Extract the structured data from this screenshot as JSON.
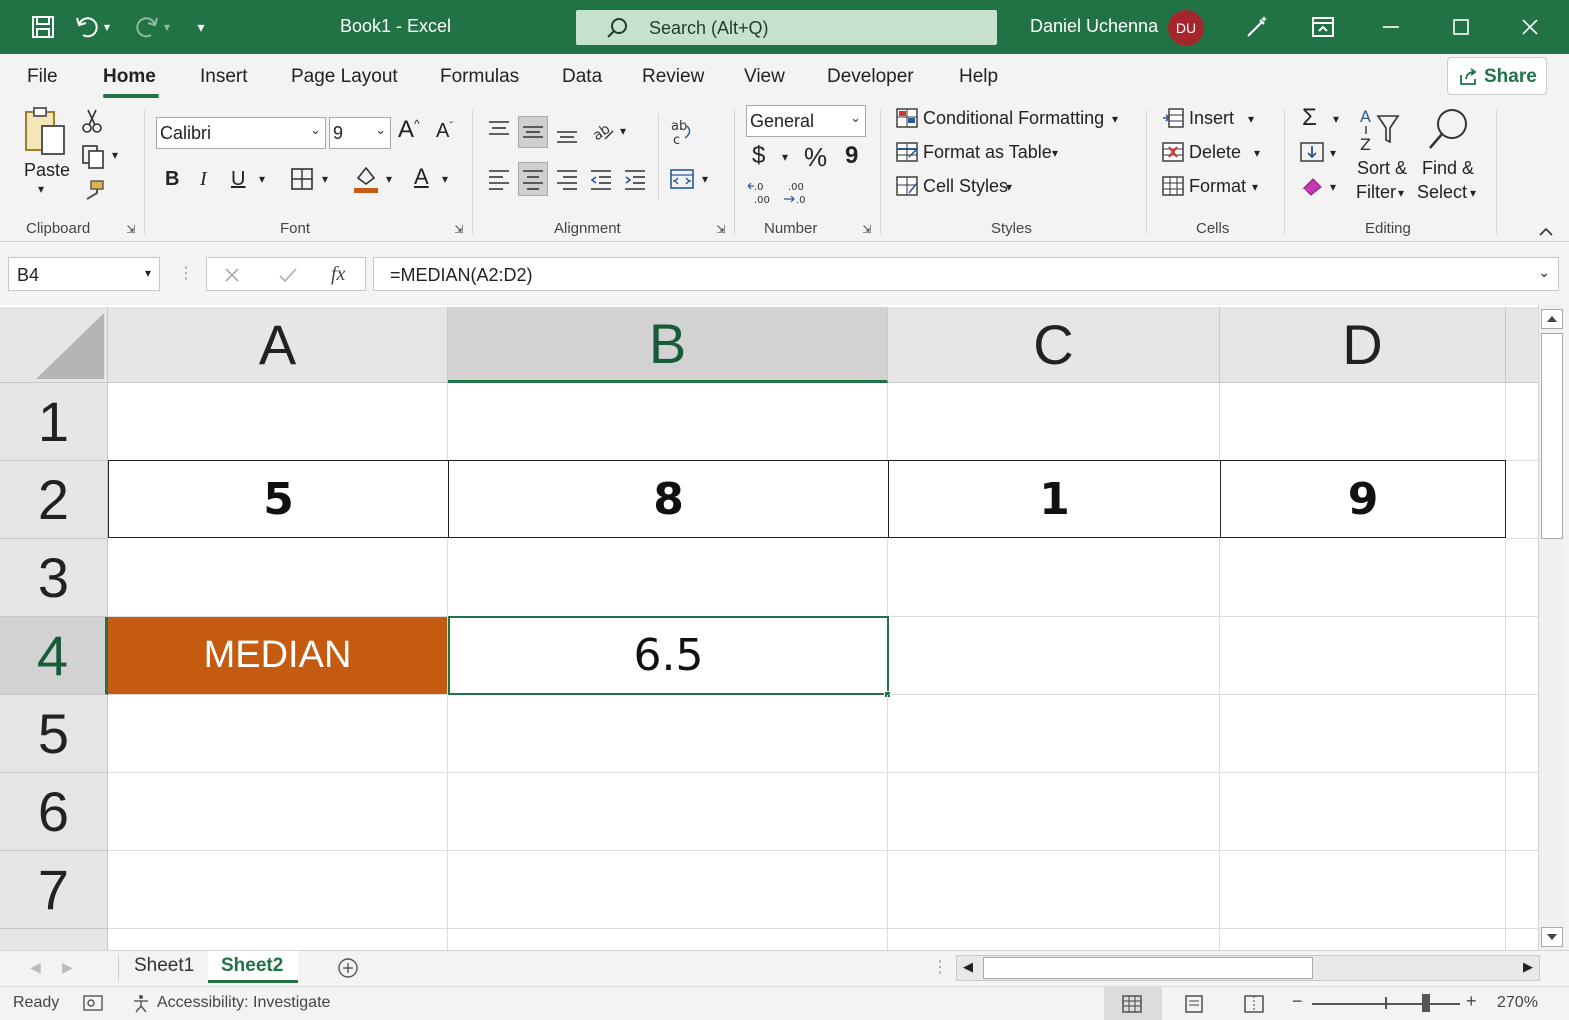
{
  "titlebar": {
    "doc_title": "Book1  -  Excel",
    "search_label": "Search (Alt+Q)",
    "user_name": "Daniel Uchenna",
    "avatar_initials": "DU",
    "color": "#217346"
  },
  "menu": {
    "tabs": [
      "File",
      "Home",
      "Insert",
      "Page Layout",
      "Formulas",
      "Data",
      "Review",
      "View",
      "Developer",
      "Help"
    ],
    "active": "Home",
    "share_label": "Share"
  },
  "ribbon": {
    "clipboard": {
      "label": "Clipboard",
      "paste": "Paste"
    },
    "font": {
      "label": "Font",
      "font_name": "Calibri",
      "font_size": "9",
      "bold": "B",
      "italic": "I",
      "underline": "U"
    },
    "alignment": {
      "label": "Alignment"
    },
    "number": {
      "label": "Number",
      "format": "General",
      "currency": "$",
      "percent": "%",
      "comma": "9"
    },
    "styles": {
      "label": "Styles",
      "conditional": "Conditional Formatting",
      "format_table": "Format as Table",
      "cell_styles": "Cell Styles"
    },
    "cells": {
      "label": "Cells",
      "insert": "Insert",
      "delete": "Delete",
      "format": "Format"
    },
    "editing": {
      "label": "Editing",
      "sort1": "Sort &",
      "sort2": "Filter",
      "find1": "Find &",
      "find2": "Select"
    }
  },
  "formula_bar": {
    "name_box": "B4",
    "formula": "=MEDIAN(A2:D2)"
  },
  "sheet": {
    "columns": [
      "A",
      "B",
      "C",
      "D"
    ],
    "rows": [
      "1",
      "2",
      "3",
      "4",
      "5",
      "6",
      "7"
    ],
    "selected_cell": "B4",
    "cells": {
      "A2": "5",
      "B2": "8",
      "C2": "1",
      "D2": "9",
      "A4": "MEDIAN",
      "B4": "6.5"
    },
    "median_fill": "#c55a11"
  },
  "sheet_tabs": {
    "tabs": [
      "Sheet1",
      "Sheet2"
    ],
    "active": "Sheet2"
  },
  "status": {
    "ready": "Ready",
    "accessibility": "Accessibility: Investigate",
    "zoom": "270%"
  }
}
